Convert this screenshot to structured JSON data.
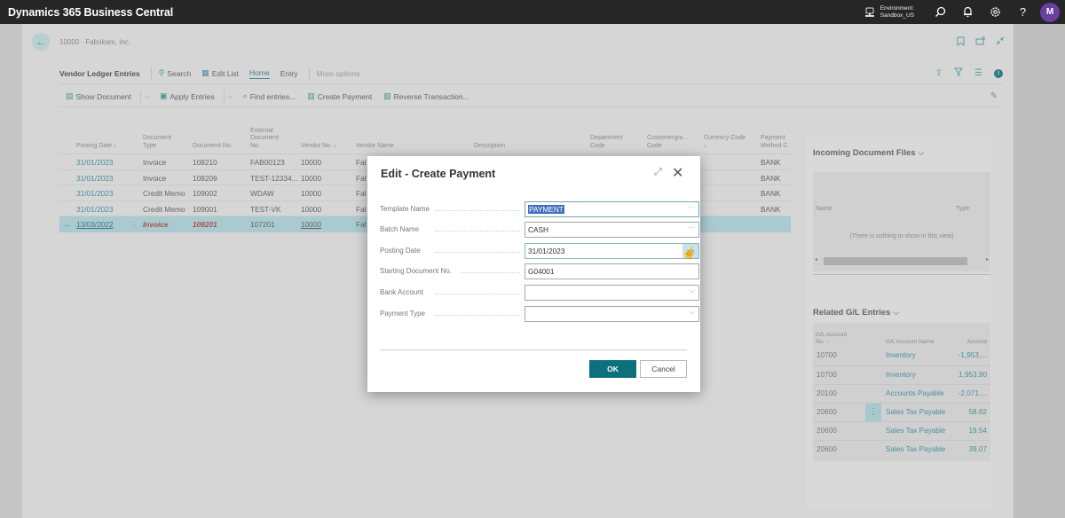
{
  "app": {
    "title": "Dynamics 365 Business Central",
    "environment_label": "Environment:",
    "environment_value": "Sandbox_US",
    "avatar_initial": "M",
    "icons": [
      "environment-icon",
      "search-icon",
      "bell-icon",
      "gear-icon",
      "help-icon"
    ]
  },
  "page": {
    "breadcrumb": "10000 · Fabrikam, Inc.",
    "action_bar": {
      "title": "Vendor Ledger Entries",
      "items": [
        {
          "label": "Search",
          "icon": "search-icon"
        },
        {
          "label": "Edit List",
          "icon": "edit-list-icon"
        },
        {
          "label": "Home",
          "active": true
        },
        {
          "label": "Entry"
        },
        {
          "label": "More options"
        }
      ]
    },
    "commands": [
      {
        "label": "Show Document",
        "icon": "document-icon",
        "has_dropdown": true
      },
      {
        "label": "Apply Entries",
        "icon": "apply-icon",
        "has_dropdown": true
      },
      {
        "label": "Find entries...",
        "icon": "find-icon"
      },
      {
        "label": "Create Payment",
        "icon": "payment-icon"
      },
      {
        "label": "Reverse Transaction...",
        "icon": "reverse-icon"
      }
    ],
    "grid": {
      "columns": [
        {
          "key": "posting_date",
          "label": "Posting Date ↓"
        },
        {
          "key": "doc_type",
          "label": "Document Type"
        },
        {
          "key": "doc_no",
          "label": "Document No."
        },
        {
          "key": "ext_doc_no",
          "label": "External Document No."
        },
        {
          "key": "vendor_no",
          "label": "Vendor No. ↓"
        },
        {
          "key": "vendor_name",
          "label": "Vendor Name"
        },
        {
          "key": "description",
          "label": "Description"
        },
        {
          "key": "dept_code",
          "label": "Department Code"
        },
        {
          "key": "custgroup_code",
          "label": "Customergro... Code"
        },
        {
          "key": "currency_code",
          "label": "Currency Code ↓"
        },
        {
          "key": "payment_method",
          "label": "Payment Method C"
        }
      ],
      "rows": [
        {
          "posting_date": "31/01/2023",
          "doc_type": "Invoice",
          "doc_no": "108210",
          "ext_doc_no": "FAB00123",
          "vendor_no": "10000",
          "vendor_name": "Fal",
          "payment_method": "BANK"
        },
        {
          "posting_date": "31/01/2023",
          "doc_type": "Invoice",
          "doc_no": "108209",
          "ext_doc_no": "TEST-12334...",
          "vendor_no": "10000",
          "vendor_name": "Fal",
          "payment_method": "BANK"
        },
        {
          "posting_date": "31/01/2023",
          "doc_type": "Credit Memo",
          "doc_no": "109002",
          "ext_doc_no": "WDAW",
          "vendor_no": "10000",
          "vendor_name": "Fal",
          "payment_method": "BANK"
        },
        {
          "posting_date": "31/01/2023",
          "doc_type": "Credit Memo",
          "doc_no": "109001",
          "ext_doc_no": "TEST-VK",
          "vendor_no": "10000",
          "vendor_name": "Fal",
          "payment_method": "BANK"
        },
        {
          "posting_date": "13/03/2022",
          "doc_type": "Invoice",
          "doc_no": "108201",
          "ext_doc_no": "107201",
          "vendor_no": "10000",
          "vendor_name": "Fal",
          "payment_method": "",
          "selected": true
        }
      ]
    }
  },
  "factbox": {
    "incoming": {
      "title": "Incoming Document Files",
      "col_name": "Name",
      "col_type": "Type",
      "empty_text": "(There is nothing to show in this view)"
    },
    "gl": {
      "title": "Related G/L Entries",
      "col_no": "G/L Account No. ↑",
      "col_name": "G/L Account Name",
      "col_amount": "Amount",
      "rows": [
        {
          "no": "10700",
          "name": "Inventory",
          "amount": "-1,953...."
        },
        {
          "no": "10700",
          "name": "Inventory",
          "amount": "1,953.90"
        },
        {
          "no": "20100",
          "name": "Accounts Payable",
          "amount": "-2,071...."
        },
        {
          "no": "20600",
          "name": "Sales Tax Payable",
          "amount": "58.62"
        },
        {
          "no": "20600",
          "name": "Sales Tax Payable",
          "amount": "19.54"
        },
        {
          "no": "20600",
          "name": "Sales Tax Payable",
          "amount": "39.07"
        }
      ]
    }
  },
  "dialog": {
    "title": "Edit - Create Payment",
    "fields": [
      {
        "label": "Template Name",
        "value": "PAYMENT",
        "button": "lookup"
      },
      {
        "label": "Batch Name",
        "value": "CASH",
        "button": "lookup"
      },
      {
        "label": "Posting Date",
        "value": "31/01/2023",
        "button": "calendar"
      },
      {
        "label": "Starting Document No.",
        "value": "G04001"
      },
      {
        "label": "Bank Account",
        "value": "",
        "button": "dropdown"
      },
      {
        "label": "Payment Type",
        "value": "",
        "button": "dropdown"
      }
    ],
    "ok_label": "OK",
    "cancel_label": "Cancel"
  },
  "colors": {
    "accent": "#0e6f7d",
    "link": "#4d8f99",
    "selected_row": "#a9cacf",
    "topbar": "#262626",
    "avatar": "#6a3fa0"
  }
}
